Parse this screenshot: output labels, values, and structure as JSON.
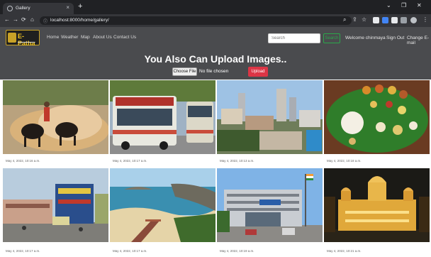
{
  "browser": {
    "tab_title": "Gallery",
    "new_tab": "+",
    "url": "localhost:8000/home/gallery/",
    "minimize": "⌄",
    "restore": "❐",
    "close": "✕"
  },
  "navbar": {
    "brand": "E-Patha",
    "links": [
      "Home",
      "Weather",
      "Map",
      "About Us",
      "Contact Us"
    ],
    "search_placeholder": "Search",
    "search_button": "Search",
    "welcome": "Welcome chinmaya",
    "sign_out": "Sign Out",
    "change": "Change E-mail"
  },
  "upload": {
    "title": "You Also Can Upload Images..",
    "choose_label": "Choose File",
    "no_file": "No file chosen",
    "upload_label": "Upload"
  },
  "gallery": [
    {
      "caption": "May 4, 2022, 10:16 a.m."
    },
    {
      "caption": "May 4, 2022, 10:17 a.m."
    },
    {
      "caption": "May 4, 2022, 10:13 a.m."
    },
    {
      "caption": "May 4, 2022, 10:18 a.m."
    },
    {
      "caption": "May 4, 2022, 10:17 a.m."
    },
    {
      "caption": "May 4, 2022, 10:17 a.m."
    },
    {
      "caption": "May 4, 2022, 10:19 a.m."
    },
    {
      "caption": "May 4, 2022, 10:21 a.m."
    }
  ],
  "colors": {
    "navbar": "#4a4b4e",
    "brand": "#f3c623",
    "upload_button": "#dc3545",
    "search_button": "#2aa84a"
  }
}
